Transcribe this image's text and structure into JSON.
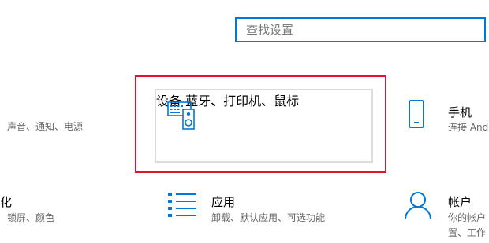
{
  "search": {
    "placeholder": "查找设置"
  },
  "tiles": [
    {
      "title": "",
      "desc": "声音、通知、电源"
    },
    {
      "title": "设备",
      "desc": "蓝牙、打印机、鼠标"
    },
    {
      "title": "手机",
      "desc": "连接 Android"
    },
    {
      "title": "化",
      "desc": "锁屏、颜色"
    },
    {
      "title": "应用",
      "desc": "卸载、默认应用、可选功能"
    },
    {
      "title": "帐户",
      "desc": "你的帐户",
      "desc2": "置、工作"
    }
  ],
  "icons": {
    "devices": "keyboard-speaker-icon",
    "phone": "phone-icon",
    "apps": "apps-list-icon",
    "accounts": "person-icon"
  },
  "colors": {
    "accent": "#0078d7",
    "highlight": "#e81123"
  }
}
